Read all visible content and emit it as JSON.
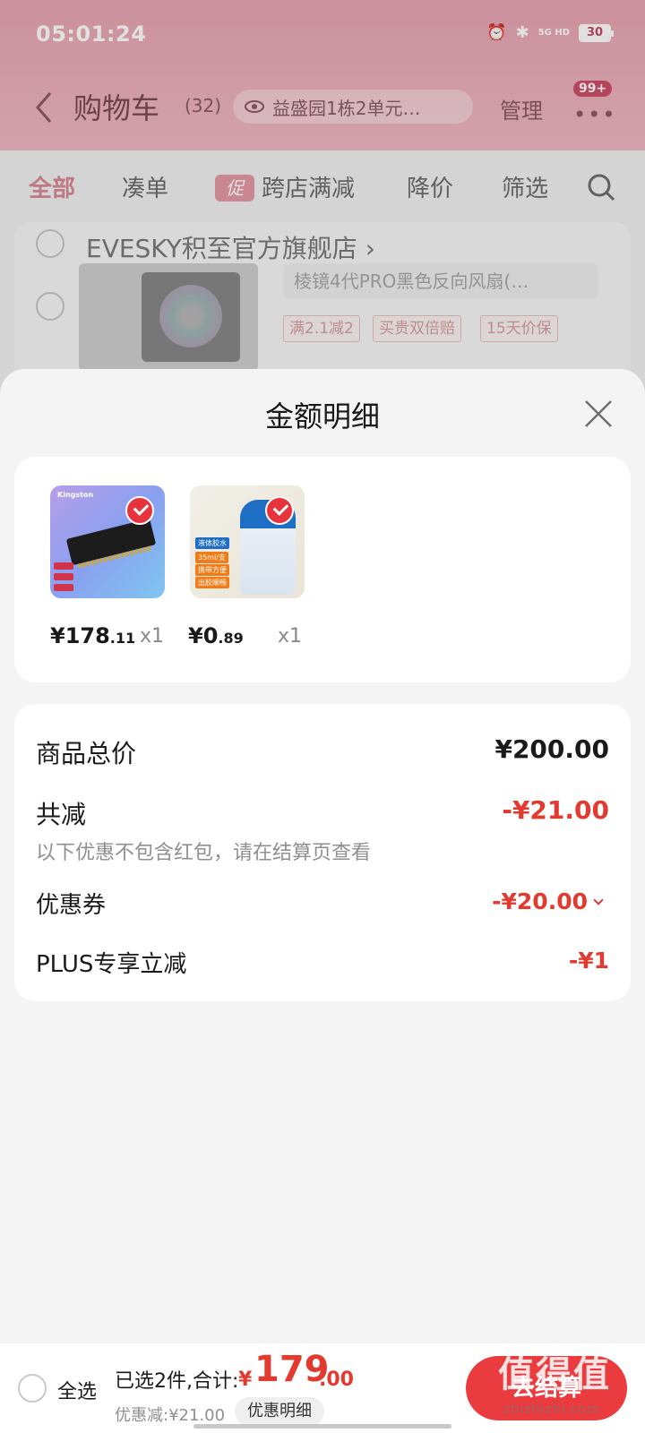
{
  "status_bar": {
    "time": "05:01:24",
    "network": "5G HD",
    "battery": "30"
  },
  "header": {
    "title": "购物车",
    "count": "(32)",
    "address": "益盛园1栋2单元…",
    "manage_label": "管理",
    "badge": "99+"
  },
  "tabs": [
    {
      "label": "全部"
    },
    {
      "label": "凑单"
    },
    {
      "label": "跨店满减",
      "tag": "促"
    },
    {
      "label": "降价"
    },
    {
      "label": "筛选"
    }
  ],
  "store": {
    "name": "EVESKY积至官方旗舰店",
    "chevron": "›",
    "variant": "棱镜4代PRO黑色反向风扇(…",
    "promos": [
      "满2.1减2",
      "买贵双倍赔",
      "15天价保"
    ]
  },
  "sheet": {
    "title": "金额明细",
    "items": [
      {
        "price_int": "¥178",
        "price_dec": ".11",
        "qty": "x1",
        "brand": "Kingston"
      },
      {
        "price_int": "¥0",
        "price_dec": ".89",
        "qty": "x1",
        "tags": [
          "液体胶水",
          "35ml/支",
          "携带方便",
          "出胶顺畅"
        ]
      }
    ],
    "summary": {
      "subtotal_label": "商品总价",
      "subtotal_value": "¥200.00",
      "reduction_label": "共减",
      "reduction_value": "-¥21.00",
      "reduction_note": "以下优惠不包含红包，请在结算页查看",
      "coupon_label": "优惠券",
      "coupon_value": "-¥20.00",
      "plus_label": "PLUS专享立减",
      "plus_value": "-¥1"
    }
  },
  "bottom_bar": {
    "select_all": "全选",
    "selected": "已选2件,合计:",
    "total_currency": "¥",
    "total_int": "179",
    "total_dec": ".00",
    "discount": "优惠减:¥21.00",
    "detail_button": "优惠明细",
    "checkout": "去结算"
  },
  "watermark": {
    "big": "值得值",
    "small": "zhizhizhi.com"
  },
  "colors": {
    "accent_red": "#e23a2e",
    "header_pink": "#f0b9c4",
    "checkout_red": "#ea3b3f"
  }
}
